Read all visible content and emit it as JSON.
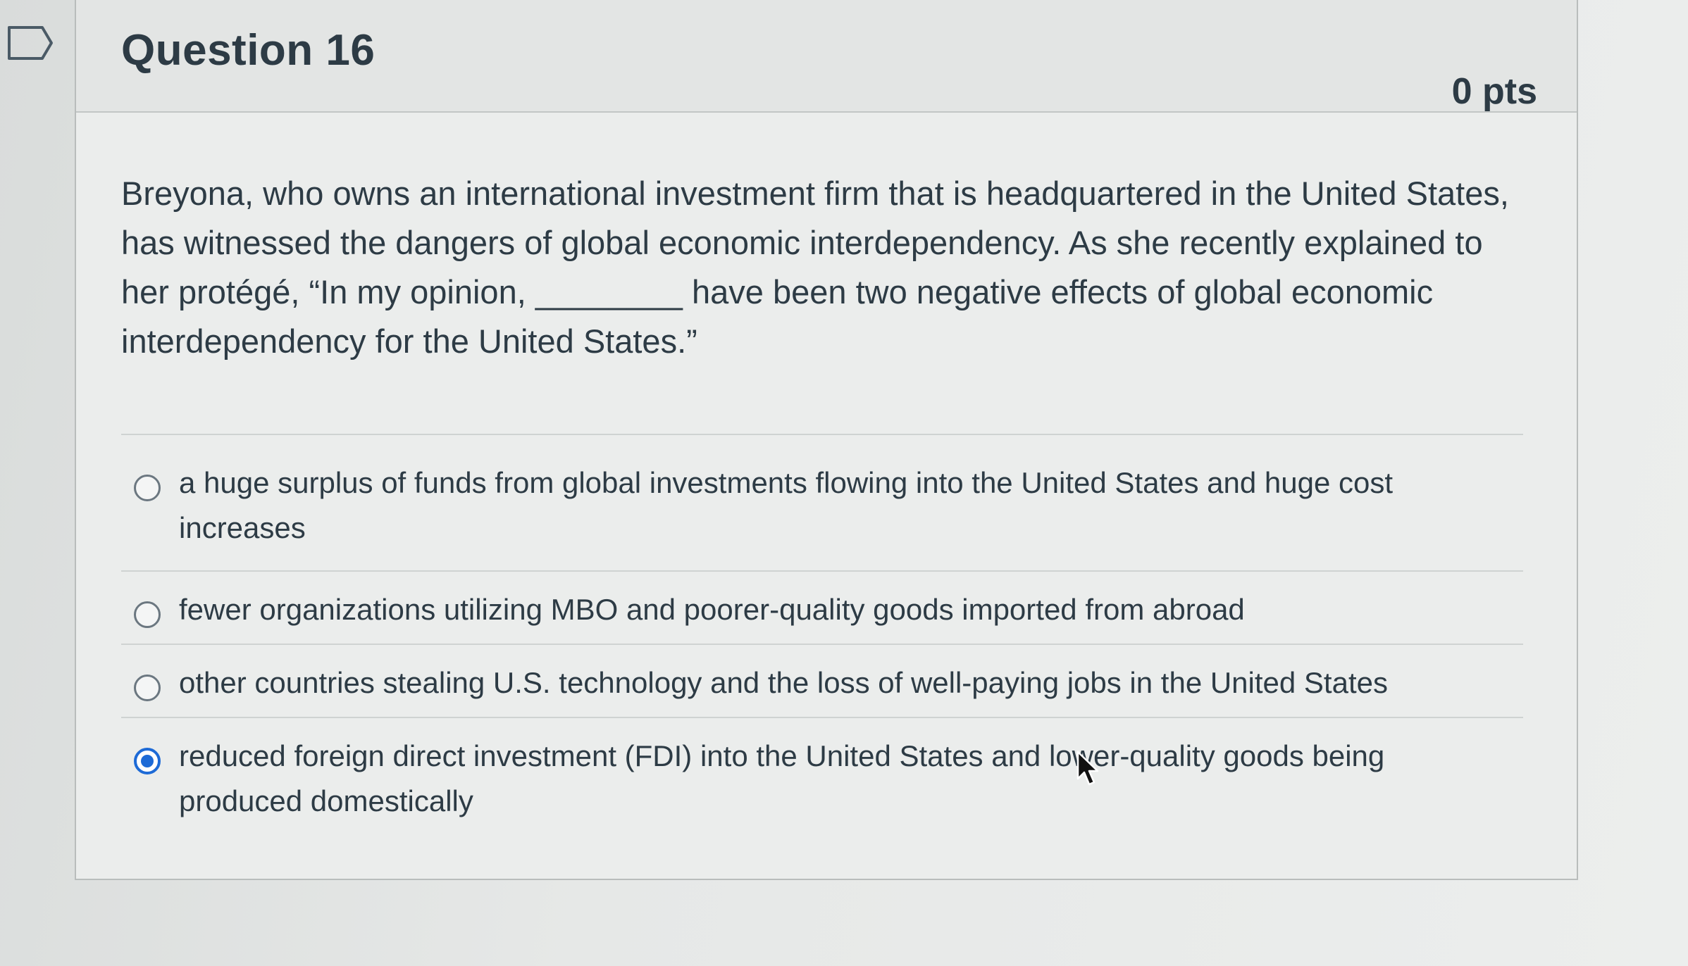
{
  "question": {
    "title": "Question 16",
    "points": "0 pts",
    "text": "Breyona, who owns an international investment firm that is headquartered in the United States, has witnessed the dangers of global economic interdependency. As she recently explained to her protégé, “In my opinion, ________ have been two negative effects of global economic interdependency for the United States.”",
    "answers": [
      {
        "label": "a huge surplus of funds from global investments flowing into the United States and huge cost increases",
        "selected": false
      },
      {
        "label": "fewer organizations utilizing MBO and poorer-quality goods imported from abroad",
        "selected": false
      },
      {
        "label": "other countries stealing U.S. technology and the loss of well-paying jobs in the United States",
        "selected": false
      },
      {
        "label": "reduced foreign direct investment (FDI) into the United States and lower-quality goods being produced domestically",
        "selected": true
      }
    ]
  },
  "icons": {
    "flag": "bookmark-flag-icon",
    "cursor": "mouse-pointer-icon"
  },
  "colors": {
    "accent": "#1d6ad6",
    "text": "#2d3b45"
  }
}
